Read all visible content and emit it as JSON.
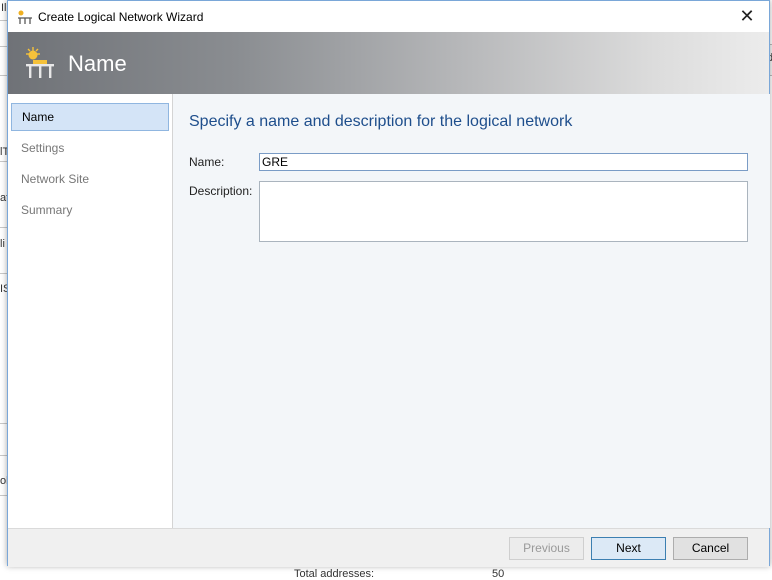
{
  "background": {
    "fragments_left": [
      "Il",
      "lT",
      "at",
      "li",
      "IS",
      "ol"
    ],
    "fragment_right": "Id",
    "bottom_label": "Total addresses:",
    "bottom_value": "50"
  },
  "window": {
    "title": "Create Logical Network Wizard",
    "close_glyph": "✕"
  },
  "banner": {
    "title": "Name"
  },
  "sidebar": {
    "items": [
      {
        "label": "Name",
        "active": true
      },
      {
        "label": "Settings",
        "active": false
      },
      {
        "label": "Network Site",
        "active": false
      },
      {
        "label": "Summary",
        "active": false
      }
    ]
  },
  "main": {
    "heading": "Specify a name and description for the logical network",
    "name_label": "Name:",
    "name_value": "GRE",
    "description_label": "Description:",
    "description_value": ""
  },
  "footer": {
    "previous_label": "Previous",
    "next_label": "Next",
    "cancel_label": "Cancel"
  },
  "colors": {
    "heading": "#1e4e8c",
    "active_nav_bg": "#d4e4f7",
    "banner_dark": "#6f7277"
  }
}
